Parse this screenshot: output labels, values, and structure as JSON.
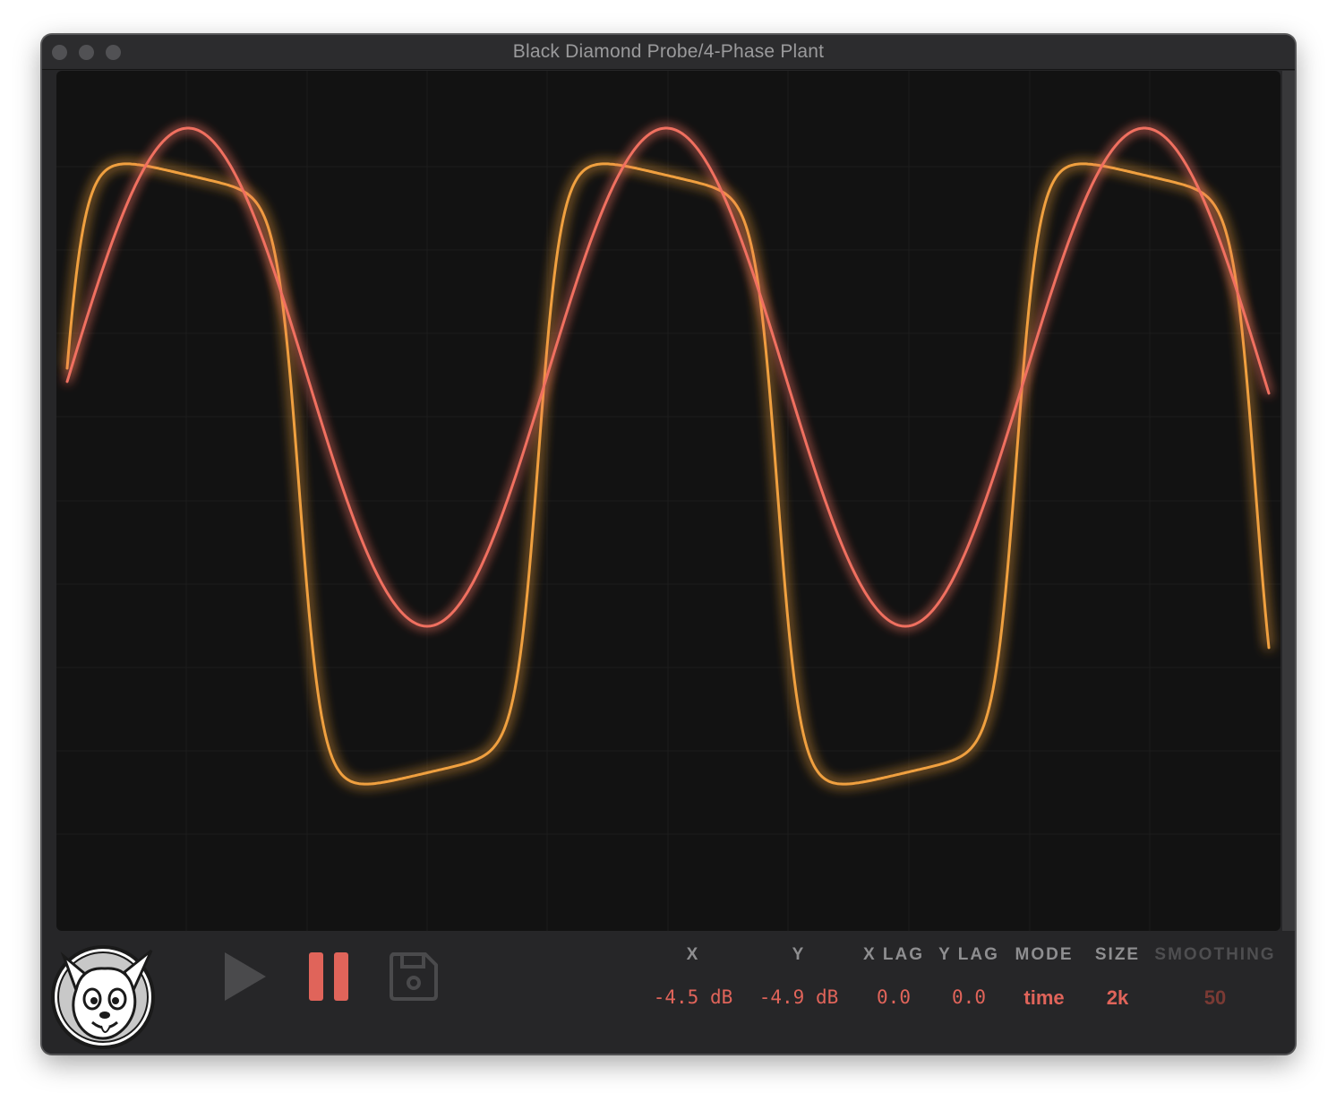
{
  "window": {
    "title": "Black Diamond Probe/4-Phase Plant"
  },
  "colors": {
    "trace_orange": "#f0a040",
    "trace_red": "#f07060",
    "accent": "#e0645a",
    "scope_bg": "#121212"
  },
  "toolbar": {
    "play_icon": "play-icon",
    "pause_icon": "pause-icon",
    "save_icon": "floppy-disk-icon"
  },
  "params": {
    "x": {
      "label": "X",
      "value": "-4.5 dB"
    },
    "y": {
      "label": "Y",
      "value": "-4.9 dB"
    },
    "x_lag": {
      "label": "X LAG",
      "value": "0.0"
    },
    "y_lag": {
      "label": "Y LAG",
      "value": "0.0"
    },
    "mode": {
      "label": "MODE",
      "value": "time"
    },
    "size": {
      "label": "SIZE",
      "value": "2k"
    },
    "smoothing": {
      "label": "SMOOTHING",
      "value": "50"
    }
  }
}
